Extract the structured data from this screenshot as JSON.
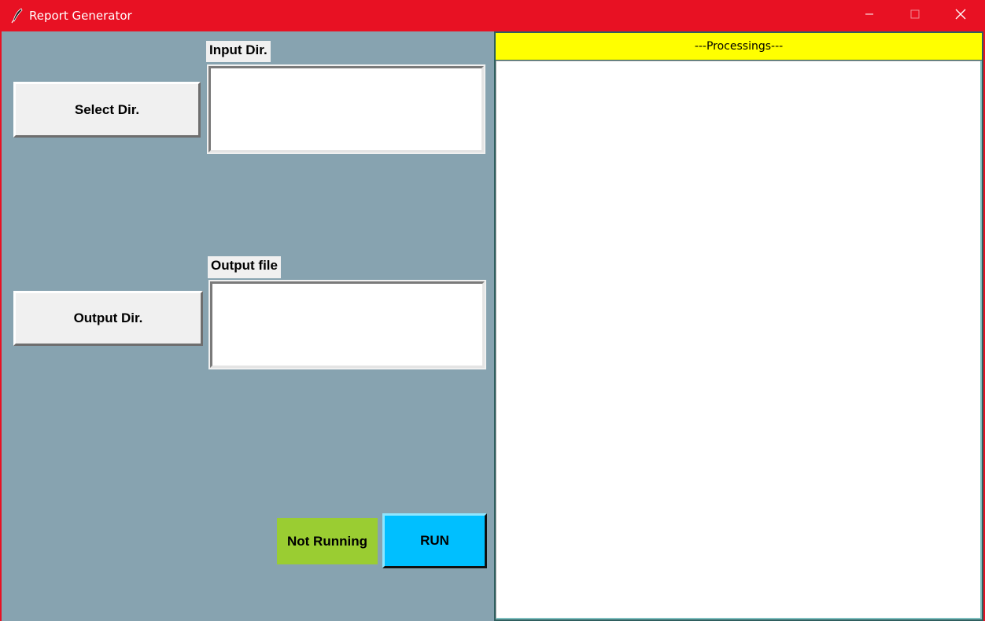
{
  "window": {
    "title": "Report Generator",
    "controls": {
      "minimize": "minimize-icon",
      "maximize": "maximize-icon",
      "close": "close-icon"
    }
  },
  "colors": {
    "titlebar": "#e81123",
    "panel_bg": "#87a3b0",
    "status_bg": "#9acd32",
    "run_bg": "#00bfff",
    "header_bg": "#ffff00"
  },
  "input": {
    "button_label": "Select Dir.",
    "field_label": "Input Dir.",
    "value": ""
  },
  "output": {
    "button_label": "Output Dir.",
    "field_label": "Output file",
    "value": ""
  },
  "status": {
    "text": "Not Running"
  },
  "run": {
    "label": "RUN"
  },
  "processing": {
    "header": "---Processings---",
    "log": ""
  }
}
